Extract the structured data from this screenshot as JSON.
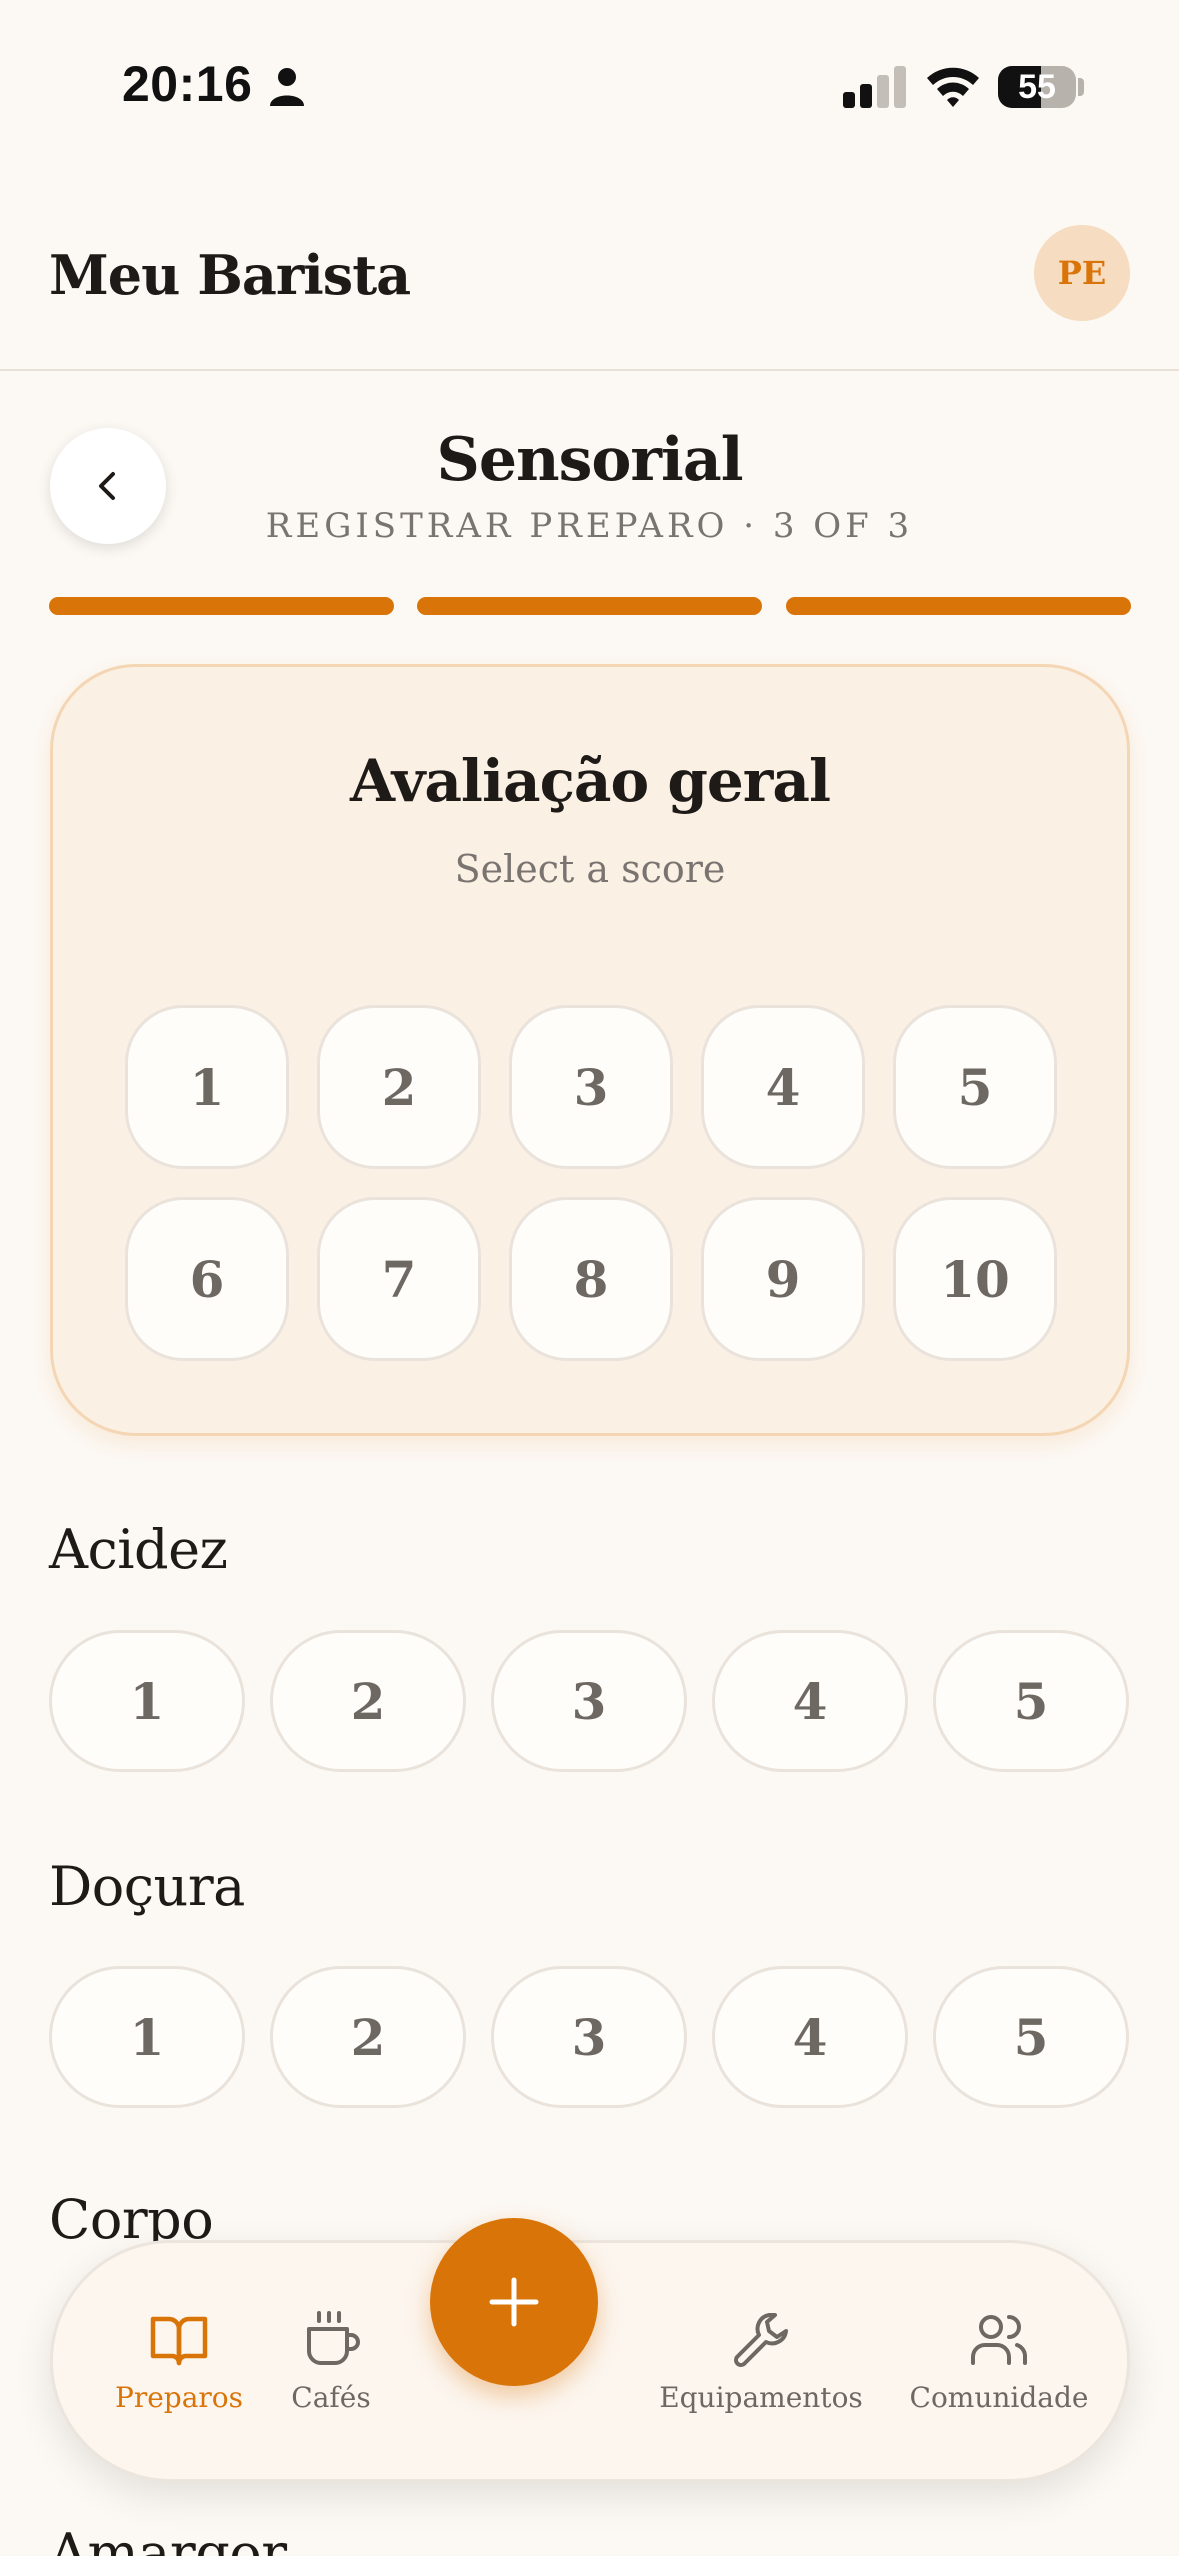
{
  "status_bar": {
    "time": "20:16",
    "battery": "55",
    "battery_level": 0.55
  },
  "header": {
    "title": "Meu Barista",
    "avatar_initials": "PE"
  },
  "step": {
    "title": "Sensorial",
    "subtitle": "REGISTRAR PREPARO · 3 OF 3",
    "steps_total": 3,
    "steps_completed": 3
  },
  "overall": {
    "title": "Avaliação geral",
    "subtitle": "Select a score",
    "scores": [
      "1",
      "2",
      "3",
      "4",
      "5",
      "6",
      "7",
      "8",
      "9",
      "10"
    ]
  },
  "attributes": [
    {
      "label": "Acidez",
      "options": [
        "1",
        "2",
        "3",
        "4",
        "5"
      ]
    },
    {
      "label": "Doçura",
      "options": [
        "1",
        "2",
        "3",
        "4",
        "5"
      ]
    },
    {
      "label": "Corpo"
    },
    {
      "label": "Amargor"
    }
  ],
  "nav": {
    "items": [
      {
        "label": "Preparos",
        "icon": "book-icon",
        "active": true
      },
      {
        "label": "Cafés",
        "icon": "coffee-cup-icon"
      },
      {
        "label": "Equipamentos",
        "icon": "wrench-icon"
      },
      {
        "label": "Comunidade",
        "icon": "users-icon"
      }
    ],
    "fab_icon": "plus-icon"
  },
  "colors": {
    "accent": "#d97409",
    "background": "#fcf8f3",
    "card": "#fbf0e4",
    "text": "#1e1a17",
    "muted": "#6e6863"
  }
}
